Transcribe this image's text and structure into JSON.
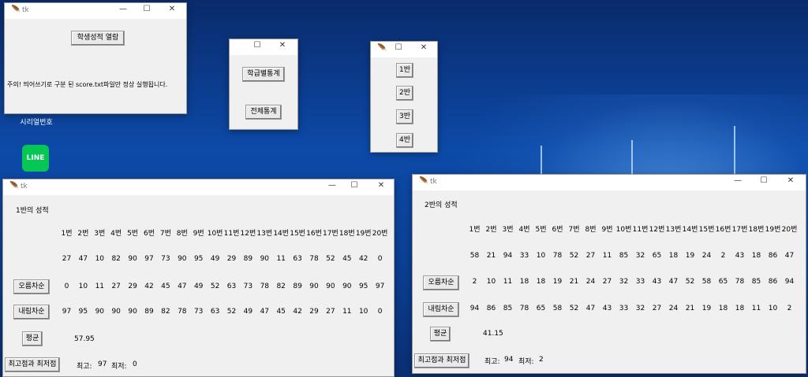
{
  "desktop": {
    "icon_labels": [
      "시리얼번호",
      "LINE"
    ]
  },
  "main_window": {
    "title": "tk",
    "open_button": "학생성적 열람",
    "notice": "주의! 띄어쓰기로 구분 된 score.txt파일만 정상 실행됩니다."
  },
  "stats_window": {
    "class_stats_button": "학급별통계",
    "total_stats_button": "전체통계"
  },
  "class_select_window": {
    "buttons": [
      "1반",
      "2반",
      "3반",
      "4반"
    ]
  },
  "class1_window": {
    "title": "tk",
    "heading": "1반의 성적",
    "headers": [
      "1번",
      "2번",
      "3번",
      "4번",
      "5번",
      "6번",
      "7번",
      "8번",
      "9번",
      "10번",
      "11번",
      "12번",
      "13번",
      "14번",
      "15번",
      "16번",
      "17번",
      "18번",
      "19번",
      "20번"
    ],
    "scores": [
      "27",
      "47",
      "10",
      "82",
      "90",
      "97",
      "73",
      "90",
      "95",
      "49",
      "29",
      "89",
      "90",
      "11",
      "63",
      "78",
      "52",
      "45",
      "42",
      "0"
    ],
    "ascending": [
      "0",
      "10",
      "11",
      "27",
      "29",
      "42",
      "45",
      "47",
      "49",
      "52",
      "63",
      "73",
      "78",
      "82",
      "89",
      "90",
      "90",
      "90",
      "95",
      "97"
    ],
    "descending": [
      "97",
      "95",
      "90",
      "90",
      "90",
      "89",
      "82",
      "78",
      "73",
      "63",
      "52",
      "49",
      "47",
      "45",
      "42",
      "29",
      "27",
      "11",
      "10",
      "0"
    ],
    "asc_button": "오름차순",
    "desc_button": "내림차순",
    "avg_button": "평균",
    "avg_value": "57.95",
    "maxmin_button": "최고점과 최저점",
    "max_label": "최고:",
    "max_value": "97",
    "min_label": "최저:",
    "min_value": "0"
  },
  "class2_window": {
    "title": "tk",
    "heading": "2반의 성적",
    "headers": [
      "1번",
      "2번",
      "3번",
      "4번",
      "5번",
      "6번",
      "7번",
      "8번",
      "9번",
      "10번",
      "11번",
      "12번",
      "13번",
      "14번",
      "15번",
      "16번",
      "17번",
      "18번",
      "19번",
      "20번"
    ],
    "scores": [
      "58",
      "21",
      "94",
      "33",
      "10",
      "78",
      "52",
      "27",
      "11",
      "85",
      "32",
      "65",
      "18",
      "19",
      "24",
      "2",
      "43",
      "18",
      "86",
      "47"
    ],
    "ascending": [
      "2",
      "10",
      "11",
      "18",
      "18",
      "19",
      "21",
      "24",
      "27",
      "32",
      "33",
      "43",
      "47",
      "52",
      "58",
      "65",
      "78",
      "85",
      "86",
      "94"
    ],
    "descending": [
      "94",
      "86",
      "85",
      "78",
      "65",
      "58",
      "52",
      "47",
      "43",
      "33",
      "32",
      "27",
      "24",
      "21",
      "19",
      "18",
      "18",
      "11",
      "10",
      "2"
    ],
    "asc_button": "오름차순",
    "desc_button": "내림차순",
    "avg_button": "평균",
    "avg_value": "41.15",
    "maxmin_button": "최고점과 최저점",
    "max_label": "최고:",
    "max_value": "94",
    "min_label": "최저:",
    "min_value": "2"
  },
  "window_controls": {
    "minimize": "—",
    "maximize": "☐",
    "close": "✕"
  }
}
